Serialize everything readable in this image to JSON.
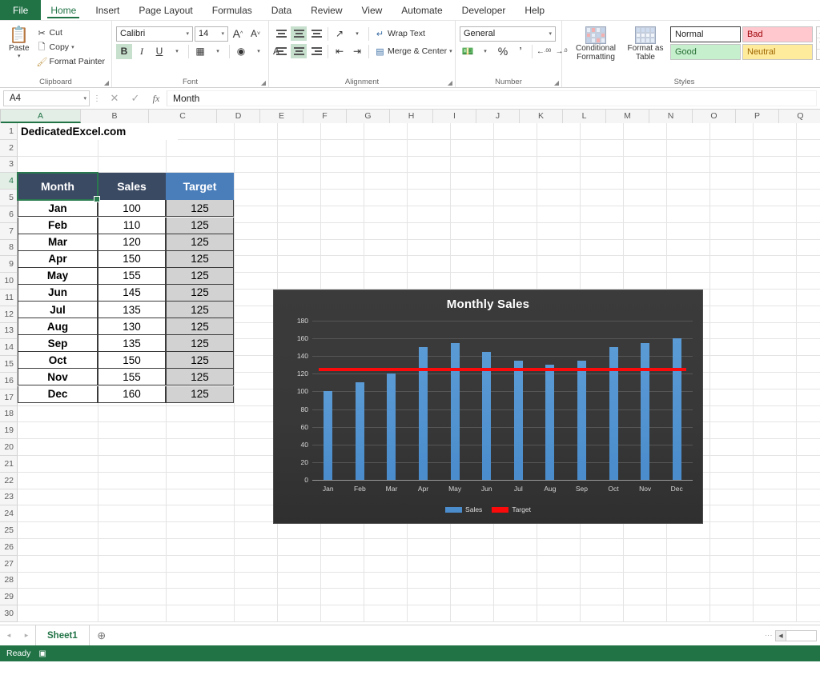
{
  "ribbon": {
    "tabs": [
      {
        "label": "File",
        "kind": "file"
      },
      {
        "label": "Home",
        "kind": "active"
      },
      {
        "label": "Insert",
        "kind": "normal"
      },
      {
        "label": "Page Layout",
        "kind": "normal"
      },
      {
        "label": "Formulas",
        "kind": "normal"
      },
      {
        "label": "Data",
        "kind": "normal"
      },
      {
        "label": "Review",
        "kind": "normal"
      },
      {
        "label": "View",
        "kind": "normal"
      },
      {
        "label": "Automate",
        "kind": "normal"
      },
      {
        "label": "Developer",
        "kind": "normal"
      },
      {
        "label": "Help",
        "kind": "normal"
      }
    ],
    "clipboard": {
      "group_label": "Clipboard",
      "paste": "Paste",
      "cut": "Cut",
      "copy": "Copy",
      "format_painter": "Format Painter"
    },
    "font": {
      "group_label": "Font",
      "font_name": "Calibri",
      "font_size": "14",
      "grow": "A",
      "shrink": "A",
      "bold": "B",
      "italic": "I",
      "underline": "U"
    },
    "alignment": {
      "group_label": "Alignment",
      "wrap_text": "Wrap Text",
      "merge_center": "Merge & Center"
    },
    "number": {
      "group_label": "Number",
      "format": "General",
      "percent": "%",
      "comma": "’"
    },
    "styles": {
      "group_label": "Styles",
      "conditional_formatting": "Conditional\nFormatting",
      "conditional_formatting_l1": "Conditional",
      "conditional_formatting_l2": "Formatting",
      "format_as_table_l1": "Format as",
      "format_as_table_l2": "Table",
      "cell_styles": [
        "Normal",
        "Bad",
        "Good",
        "Neutral"
      ]
    }
  },
  "formula_bar": {
    "name_box": "A4",
    "formula": "Month",
    "cancel": "✕",
    "enter": "✓",
    "fx": "fx"
  },
  "grid": {
    "columns": [
      "A",
      "B",
      "C",
      "D",
      "E",
      "F",
      "G",
      "H",
      "I",
      "J",
      "K",
      "L",
      "M",
      "N",
      "O",
      "P",
      "Q"
    ],
    "selected_column": "A",
    "selected_row": 4,
    "rows": [
      1,
      2,
      3,
      4,
      5,
      6,
      7,
      8,
      9,
      10,
      11,
      12,
      13,
      14,
      15,
      16,
      17,
      18,
      19,
      20,
      21,
      22,
      23,
      24,
      25,
      26,
      27,
      28,
      29,
      30
    ],
    "brand_cell": "DedicatedExcel.com",
    "table_headers": [
      "Month",
      "Sales",
      "Target"
    ],
    "table_rows": [
      {
        "month": "Jan",
        "sales": "100",
        "target": "125"
      },
      {
        "month": "Feb",
        "sales": "110",
        "target": "125"
      },
      {
        "month": "Mar",
        "sales": "120",
        "target": "125"
      },
      {
        "month": "Apr",
        "sales": "150",
        "target": "125"
      },
      {
        "month": "May",
        "sales": "155",
        "target": "125"
      },
      {
        "month": "Jun",
        "sales": "145",
        "target": "125"
      },
      {
        "month": "Jul",
        "sales": "135",
        "target": "125"
      },
      {
        "month": "Aug",
        "sales": "130",
        "target": "125"
      },
      {
        "month": "Sep",
        "sales": "135",
        "target": "125"
      },
      {
        "month": "Oct",
        "sales": "150",
        "target": "125"
      },
      {
        "month": "Nov",
        "sales": "155",
        "target": "125"
      },
      {
        "month": "Dec",
        "sales": "160",
        "target": "125"
      }
    ]
  },
  "chart_data": {
    "type": "bar",
    "title": "Monthly Sales",
    "categories": [
      "Jan",
      "Feb",
      "Mar",
      "Apr",
      "May",
      "Jun",
      "Jul",
      "Aug",
      "Sep",
      "Oct",
      "Nov",
      "Dec"
    ],
    "series": [
      {
        "name": "Sales",
        "type": "bar",
        "color": "#4a8ccc",
        "values": [
          100,
          110,
          120,
          150,
          155,
          145,
          135,
          130,
          135,
          150,
          155,
          160
        ]
      },
      {
        "name": "Target",
        "type": "line",
        "color": "#fa0a0a",
        "values": [
          125,
          125,
          125,
          125,
          125,
          125,
          125,
          125,
          125,
          125,
          125,
          125
        ]
      }
    ],
    "xlabel": "",
    "ylabel": "",
    "ylim": [
      0,
      180
    ],
    "yticks": [
      0,
      20,
      40,
      60,
      80,
      100,
      120,
      140,
      160,
      180
    ],
    "grid": true,
    "legend_position": "bottom",
    "plot_background": "#383838"
  },
  "sheet_bar": {
    "prev": "◂",
    "next": "▸",
    "tabs": [
      "Sheet1"
    ],
    "add": "⊕"
  },
  "status_bar": {
    "state": "Ready",
    "mode_icon": "recording-icon"
  },
  "colors": {
    "excel_green": "#217346",
    "header_dark": "#3b4a63",
    "header_blue": "#4a7ebb",
    "bar_blue": "#4a8ccc",
    "target_red": "#fa0a0a"
  }
}
